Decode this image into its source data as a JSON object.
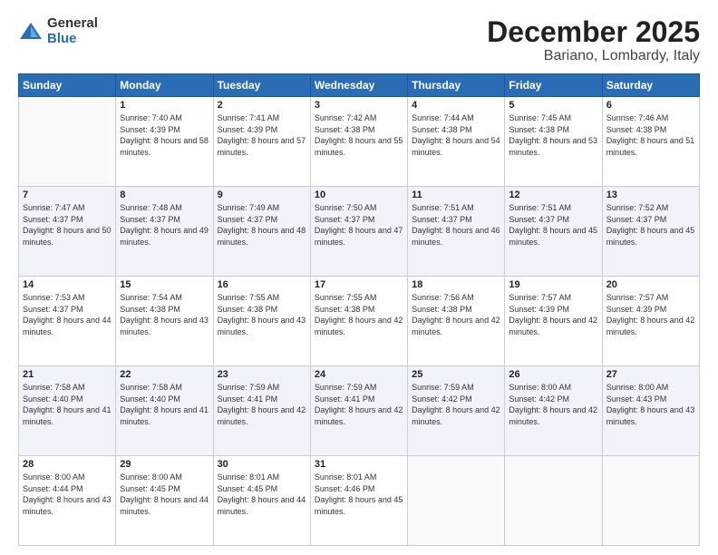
{
  "logo": {
    "general": "General",
    "blue": "Blue"
  },
  "header": {
    "month": "December 2025",
    "location": "Bariano, Lombardy, Italy"
  },
  "weekdays": [
    "Sunday",
    "Monday",
    "Tuesday",
    "Wednesday",
    "Thursday",
    "Friday",
    "Saturday"
  ],
  "weeks": [
    [
      {
        "num": "",
        "sunrise": "",
        "sunset": "",
        "daylight": ""
      },
      {
        "num": "1",
        "sunrise": "Sunrise: 7:40 AM",
        "sunset": "Sunset: 4:39 PM",
        "daylight": "Daylight: 8 hours and 58 minutes."
      },
      {
        "num": "2",
        "sunrise": "Sunrise: 7:41 AM",
        "sunset": "Sunset: 4:39 PM",
        "daylight": "Daylight: 8 hours and 57 minutes."
      },
      {
        "num": "3",
        "sunrise": "Sunrise: 7:42 AM",
        "sunset": "Sunset: 4:38 PM",
        "daylight": "Daylight: 8 hours and 55 minutes."
      },
      {
        "num": "4",
        "sunrise": "Sunrise: 7:44 AM",
        "sunset": "Sunset: 4:38 PM",
        "daylight": "Daylight: 8 hours and 54 minutes."
      },
      {
        "num": "5",
        "sunrise": "Sunrise: 7:45 AM",
        "sunset": "Sunset: 4:38 PM",
        "daylight": "Daylight: 8 hours and 53 minutes."
      },
      {
        "num": "6",
        "sunrise": "Sunrise: 7:46 AM",
        "sunset": "Sunset: 4:38 PM",
        "daylight": "Daylight: 8 hours and 51 minutes."
      }
    ],
    [
      {
        "num": "7",
        "sunrise": "Sunrise: 7:47 AM",
        "sunset": "Sunset: 4:37 PM",
        "daylight": "Daylight: 8 hours and 50 minutes."
      },
      {
        "num": "8",
        "sunrise": "Sunrise: 7:48 AM",
        "sunset": "Sunset: 4:37 PM",
        "daylight": "Daylight: 8 hours and 49 minutes."
      },
      {
        "num": "9",
        "sunrise": "Sunrise: 7:49 AM",
        "sunset": "Sunset: 4:37 PM",
        "daylight": "Daylight: 8 hours and 48 minutes."
      },
      {
        "num": "10",
        "sunrise": "Sunrise: 7:50 AM",
        "sunset": "Sunset: 4:37 PM",
        "daylight": "Daylight: 8 hours and 47 minutes."
      },
      {
        "num": "11",
        "sunrise": "Sunrise: 7:51 AM",
        "sunset": "Sunset: 4:37 PM",
        "daylight": "Daylight: 8 hours and 46 minutes."
      },
      {
        "num": "12",
        "sunrise": "Sunrise: 7:51 AM",
        "sunset": "Sunset: 4:37 PM",
        "daylight": "Daylight: 8 hours and 45 minutes."
      },
      {
        "num": "13",
        "sunrise": "Sunrise: 7:52 AM",
        "sunset": "Sunset: 4:37 PM",
        "daylight": "Daylight: 8 hours and 45 minutes."
      }
    ],
    [
      {
        "num": "14",
        "sunrise": "Sunrise: 7:53 AM",
        "sunset": "Sunset: 4:37 PM",
        "daylight": "Daylight: 8 hours and 44 minutes."
      },
      {
        "num": "15",
        "sunrise": "Sunrise: 7:54 AM",
        "sunset": "Sunset: 4:38 PM",
        "daylight": "Daylight: 8 hours and 43 minutes."
      },
      {
        "num": "16",
        "sunrise": "Sunrise: 7:55 AM",
        "sunset": "Sunset: 4:38 PM",
        "daylight": "Daylight: 8 hours and 43 minutes."
      },
      {
        "num": "17",
        "sunrise": "Sunrise: 7:55 AM",
        "sunset": "Sunset: 4:38 PM",
        "daylight": "Daylight: 8 hours and 42 minutes."
      },
      {
        "num": "18",
        "sunrise": "Sunrise: 7:56 AM",
        "sunset": "Sunset: 4:38 PM",
        "daylight": "Daylight: 8 hours and 42 minutes."
      },
      {
        "num": "19",
        "sunrise": "Sunrise: 7:57 AM",
        "sunset": "Sunset: 4:39 PM",
        "daylight": "Daylight: 8 hours and 42 minutes."
      },
      {
        "num": "20",
        "sunrise": "Sunrise: 7:57 AM",
        "sunset": "Sunset: 4:39 PM",
        "daylight": "Daylight: 8 hours and 42 minutes."
      }
    ],
    [
      {
        "num": "21",
        "sunrise": "Sunrise: 7:58 AM",
        "sunset": "Sunset: 4:40 PM",
        "daylight": "Daylight: 8 hours and 41 minutes."
      },
      {
        "num": "22",
        "sunrise": "Sunrise: 7:58 AM",
        "sunset": "Sunset: 4:40 PM",
        "daylight": "Daylight: 8 hours and 41 minutes."
      },
      {
        "num": "23",
        "sunrise": "Sunrise: 7:59 AM",
        "sunset": "Sunset: 4:41 PM",
        "daylight": "Daylight: 8 hours and 42 minutes."
      },
      {
        "num": "24",
        "sunrise": "Sunrise: 7:59 AM",
        "sunset": "Sunset: 4:41 PM",
        "daylight": "Daylight: 8 hours and 42 minutes."
      },
      {
        "num": "25",
        "sunrise": "Sunrise: 7:59 AM",
        "sunset": "Sunset: 4:42 PM",
        "daylight": "Daylight: 8 hours and 42 minutes."
      },
      {
        "num": "26",
        "sunrise": "Sunrise: 8:00 AM",
        "sunset": "Sunset: 4:42 PM",
        "daylight": "Daylight: 8 hours and 42 minutes."
      },
      {
        "num": "27",
        "sunrise": "Sunrise: 8:00 AM",
        "sunset": "Sunset: 4:43 PM",
        "daylight": "Daylight: 8 hours and 43 minutes."
      }
    ],
    [
      {
        "num": "28",
        "sunrise": "Sunrise: 8:00 AM",
        "sunset": "Sunset: 4:44 PM",
        "daylight": "Daylight: 8 hours and 43 minutes."
      },
      {
        "num": "29",
        "sunrise": "Sunrise: 8:00 AM",
        "sunset": "Sunset: 4:45 PM",
        "daylight": "Daylight: 8 hours and 44 minutes."
      },
      {
        "num": "30",
        "sunrise": "Sunrise: 8:01 AM",
        "sunset": "Sunset: 4:45 PM",
        "daylight": "Daylight: 8 hours and 44 minutes."
      },
      {
        "num": "31",
        "sunrise": "Sunrise: 8:01 AM",
        "sunset": "Sunset: 4:46 PM",
        "daylight": "Daylight: 8 hours and 45 minutes."
      },
      {
        "num": "",
        "sunrise": "",
        "sunset": "",
        "daylight": ""
      },
      {
        "num": "",
        "sunrise": "",
        "sunset": "",
        "daylight": ""
      },
      {
        "num": "",
        "sunrise": "",
        "sunset": "",
        "daylight": ""
      }
    ]
  ]
}
